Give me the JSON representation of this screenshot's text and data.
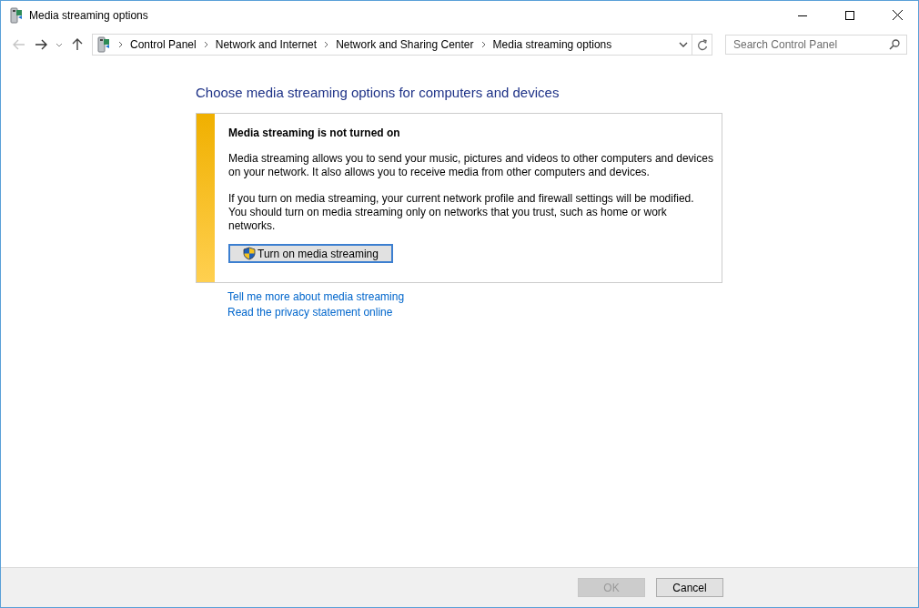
{
  "window": {
    "title": "Media streaming options"
  },
  "navigation": {
    "back_disabled": true,
    "forward_disabled": false
  },
  "breadcrumb": [
    "Control Panel",
    "Network and Internet",
    "Network and Sharing Center",
    "Media streaming options"
  ],
  "search": {
    "placeholder": "Search Control Panel"
  },
  "heading": "Choose media streaming options for computers and devices",
  "notice": {
    "title": "Media streaming is not turned on",
    "paragraphs": [
      "Media streaming allows you to send your music, pictures and videos to other computers and devices on your network.  It also allows you to receive media from other computers and devices.",
      "If you turn on media streaming, your current network profile and firewall settings will be modified. You should turn on media streaming only on networks that you trust, such as home or work networks."
    ],
    "button": "Turn on media streaming"
  },
  "links": [
    "Tell me more about media streaming",
    "Read the privacy statement online"
  ],
  "buttons": [
    {
      "label": "OK",
      "disabled": true
    },
    {
      "label": "Cancel",
      "disabled": false
    }
  ]
}
